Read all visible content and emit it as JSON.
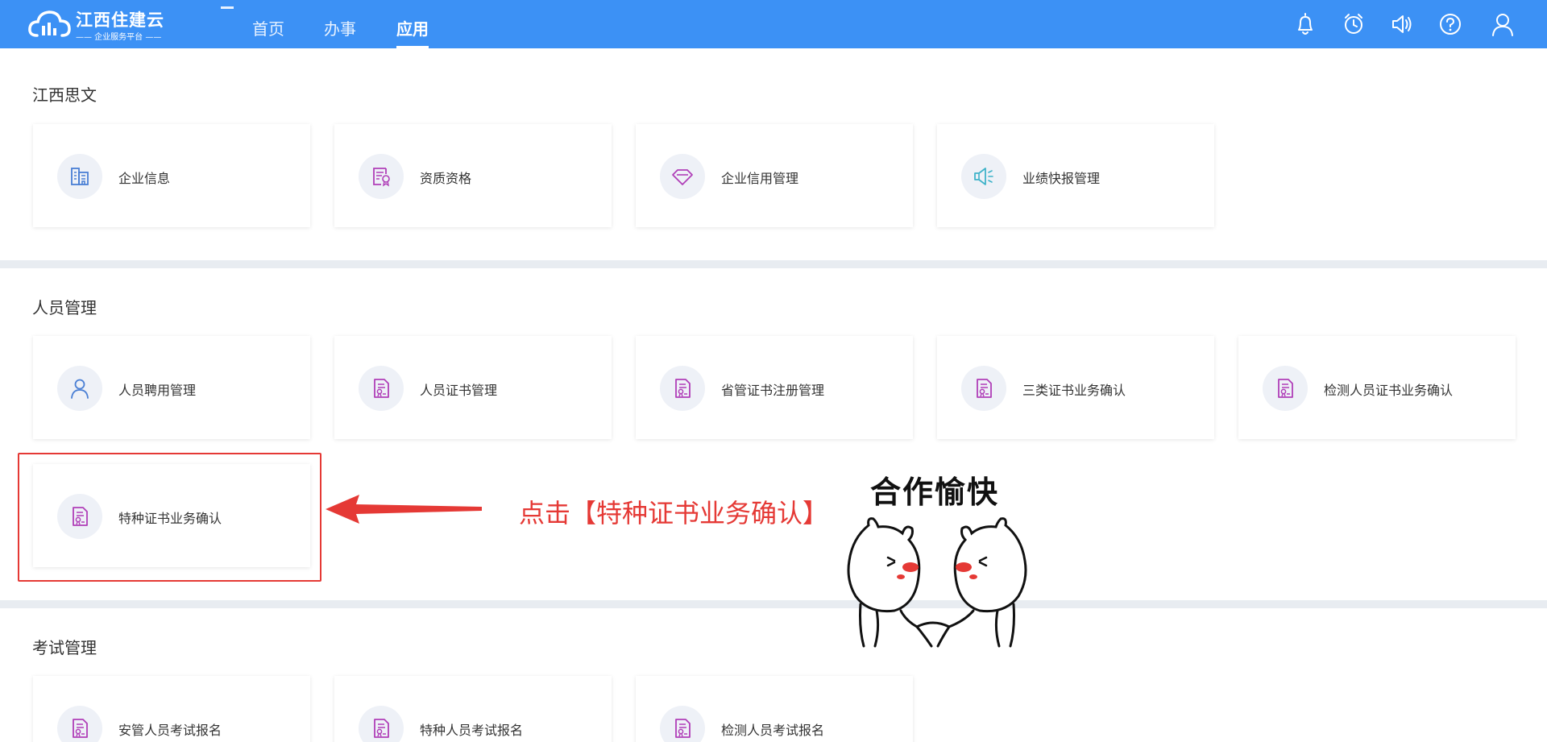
{
  "header": {
    "logo_title": "江西住建云",
    "logo_subtitle": "—— 企业服务平台 ——",
    "nav": [
      "首页",
      "办事",
      "应用"
    ],
    "active_nav": "应用",
    "icons": [
      "bell-icon",
      "alarm-clock-icon",
      "speaker-icon",
      "help-icon",
      "user-icon"
    ]
  },
  "sections": [
    {
      "title": "江西思文",
      "cards": [
        {
          "label": "企业信息",
          "icon": "building-icon"
        },
        {
          "label": "资质资格",
          "icon": "certificate-document-icon"
        },
        {
          "label": "企业信用管理",
          "icon": "diamond-icon"
        },
        {
          "label": "业绩快报管理",
          "icon": "megaphone-icon"
        }
      ]
    },
    {
      "title": "人员管理",
      "cards": [
        {
          "label": "人员聘用管理",
          "icon": "person-icon"
        },
        {
          "label": "人员证书管理",
          "icon": "certificate-icon"
        },
        {
          "label": "省管证书注册管理",
          "icon": "certificate-icon"
        },
        {
          "label": "三类证书业务确认",
          "icon": "certificate-icon"
        },
        {
          "label": "检测人员证书业务确认",
          "icon": "certificate-icon"
        },
        {
          "label": "特种证书业务确认",
          "icon": "certificate-icon"
        }
      ]
    },
    {
      "title": "考试管理",
      "cards": [
        {
          "label": "安管人员考试报名",
          "icon": "certificate-icon"
        },
        {
          "label": "特种人员考试报名",
          "icon": "certificate-icon"
        },
        {
          "label": "检测人员考试报名",
          "icon": "certificate-icon"
        }
      ]
    }
  ],
  "annotation": {
    "instruction": "点击【特种证书业务确认】",
    "sticker_text": "合作愉快"
  },
  "colors": {
    "header": "#3c91f5",
    "accent_blue": "#4a7fd4",
    "accent_purple": "#b03fb8",
    "highlight_red": "#e53935"
  }
}
